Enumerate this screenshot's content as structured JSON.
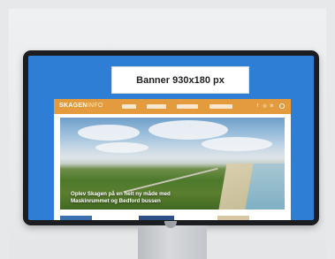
{
  "banner": {
    "label": "Banner 930x180 px"
  },
  "site": {
    "logo": {
      "bold": "SKAGEN",
      "light": "INFO"
    },
    "hero": {
      "caption": "Oplev Skagen på en helt ny måde med Maskinrummet og Bedford bussen"
    }
  },
  "colors": {
    "screen_bg": "#2f7ed6",
    "nav_bar": "#e39b3e",
    "monitor_bezel": "#1b1d21"
  }
}
